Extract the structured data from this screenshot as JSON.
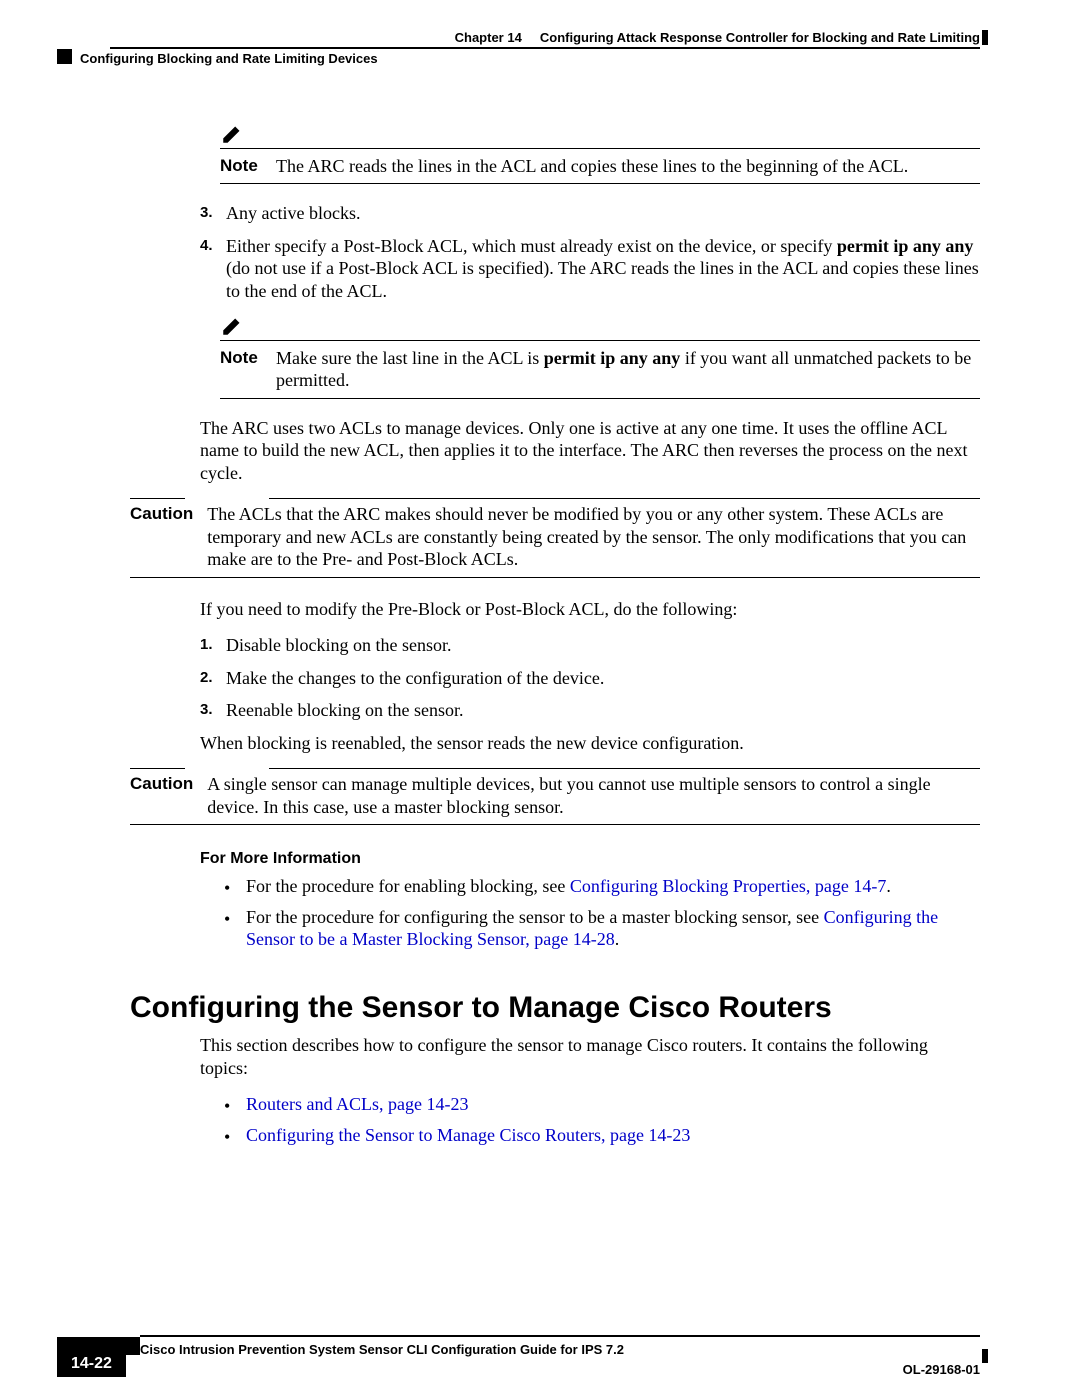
{
  "header": {
    "chapter_label": "Chapter 14",
    "chapter_title": "Configuring Attack Response Controller for Blocking and Rate Limiting",
    "section_left": "Configuring Blocking and Rate Limiting Devices"
  },
  "note1": {
    "label": "Note",
    "text": "The ARC reads the lines in the ACL and copies these lines to the beginning of the ACL."
  },
  "steps_a": [
    {
      "n": "3.",
      "text": "Any active blocks."
    },
    {
      "n": "4.",
      "prefix": "Either specify a Post-Block ACL, which must already exist on the device, or specify ",
      "bold1": "permit ip any any",
      "suffix": " (do not use if a Post-Block ACL is specified). The ARC reads the lines in the ACL and copies these lines to the end of the ACL."
    }
  ],
  "note2": {
    "label": "Note",
    "prefix": "Make sure the last line in the ACL is ",
    "bold": "permit ip any any",
    "suffix": " if you want all unmatched packets to be permitted."
  },
  "para1": "The ARC uses two ACLs to manage devices. Only one is active at any one time. It uses the offline ACL name to build the new ACL, then applies it to the interface. The ARC then reverses the process on the next cycle.",
  "caution1": {
    "label": "Caution",
    "text": "The ACLs that the ARC makes should never be modified by you or any other system. These ACLs are temporary and new ACLs are constantly being created by the sensor. The only modifications that you can make are to the Pre- and Post-Block ACLs."
  },
  "para2": "If you need to modify the Pre-Block or Post-Block ACL, do the following:",
  "steps_b": [
    {
      "n": "1.",
      "text": "Disable blocking on the sensor."
    },
    {
      "n": "2.",
      "text": "Make the changes to the configuration of the device."
    },
    {
      "n": "3.",
      "text": "Reenable blocking on the sensor."
    }
  ],
  "para3": "When blocking is reenabled, the sensor reads the new device configuration.",
  "caution2": {
    "label": "Caution",
    "text": "A single sensor can manage multiple devices, but you cannot use multiple sensors to control a single device. In this case, use a master blocking sensor."
  },
  "fmi_heading": "For More Information",
  "fmi_items": [
    {
      "prefix": "For the procedure for enabling blocking, see ",
      "link": "Configuring Blocking Properties, page 14-7",
      "suffix": "."
    },
    {
      "prefix": "For the procedure for configuring the sensor to be a master blocking sensor, see ",
      "link": "Configuring the Sensor to be a Master Blocking Sensor, page 14-28",
      "suffix": "."
    }
  ],
  "h1": "Configuring the Sensor to Manage Cisco Routers",
  "para4": "This section describes how to configure the sensor to manage Cisco routers. It contains the following topics:",
  "topics": [
    {
      "link": "Routers and ACLs, page 14-23"
    },
    {
      "link": "Configuring the Sensor to Manage Cisco Routers, page 14-23"
    }
  ],
  "footer": {
    "book": "Cisco Intrusion Prevention System Sensor CLI Configuration Guide for IPS 7.2",
    "docid": "OL-29168-01",
    "pagenum": "14-22"
  }
}
